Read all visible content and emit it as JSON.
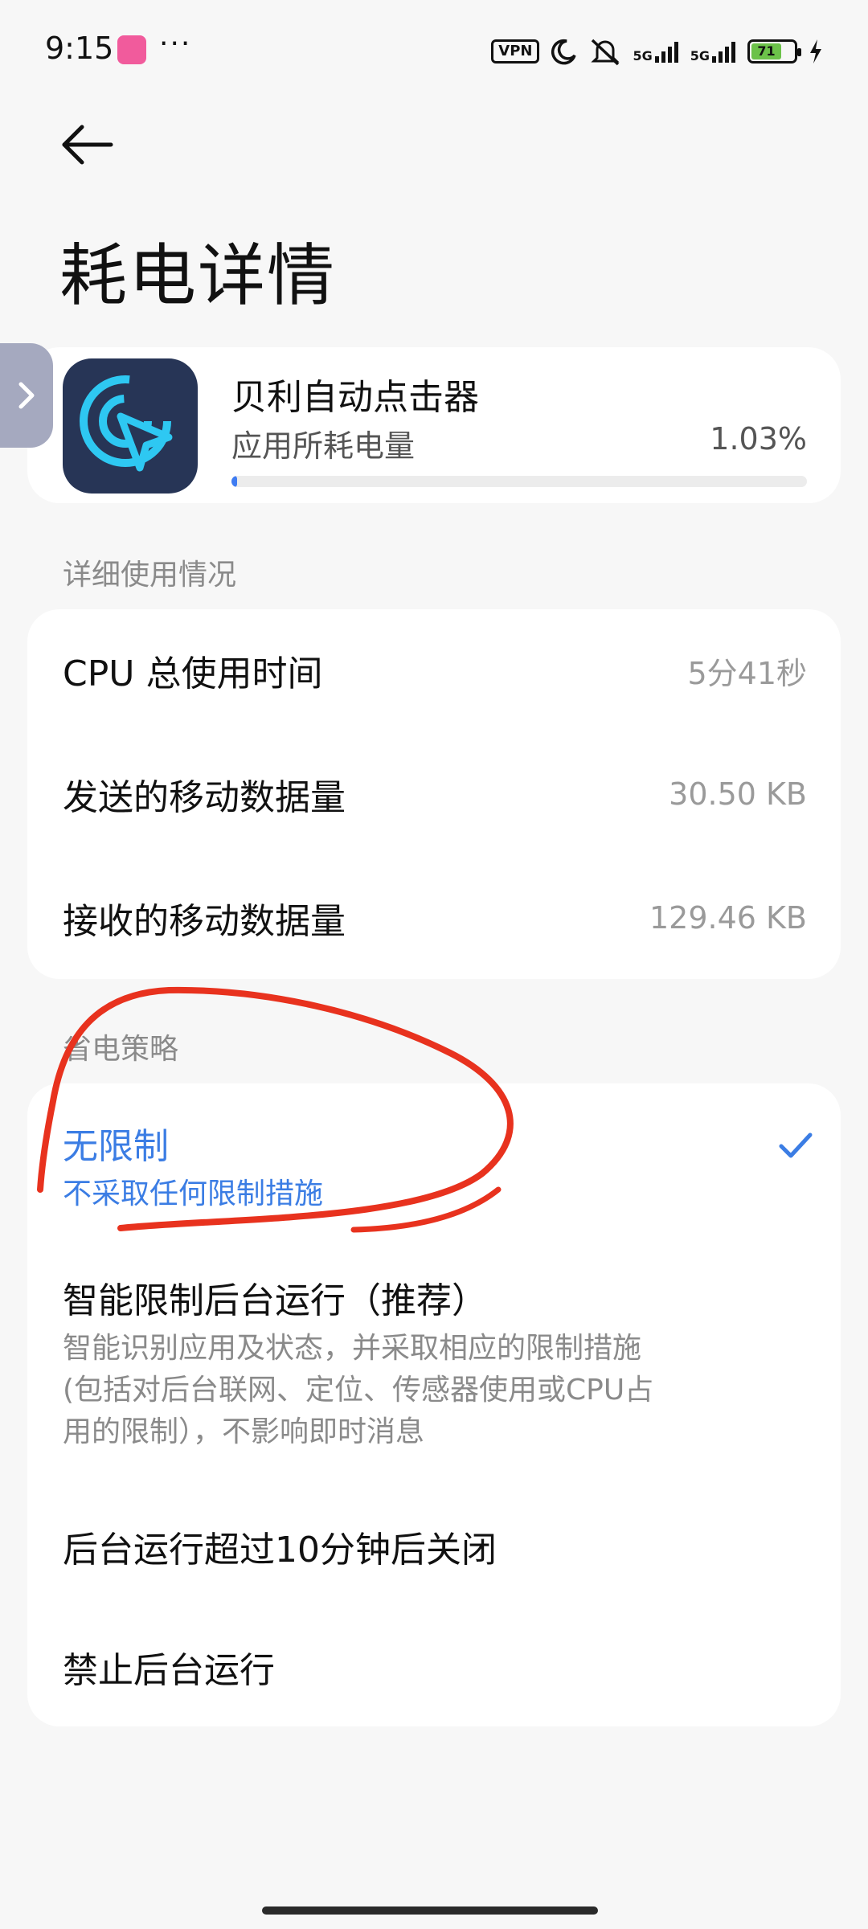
{
  "status_bar": {
    "time": "9:15",
    "dots": "···",
    "vpn": "VPN",
    "sig1": "5G",
    "sig2": "5G",
    "battery": "71"
  },
  "header": {
    "title": "耗电详情"
  },
  "app_card": {
    "name": "贝利自动点击器",
    "usage_label": "应用所耗电量",
    "usage_value": "1.03%",
    "usage_percent": 1.03
  },
  "detail_section": {
    "label": "详细使用情况",
    "rows": [
      {
        "label": "CPU 总使用时间",
        "value": "5分41秒"
      },
      {
        "label": "发送的移动数据量",
        "value": "30.50 KB"
      },
      {
        "label": "接收的移动数据量",
        "value": "129.46 KB"
      }
    ]
  },
  "policy_section": {
    "label": "省电策略",
    "options": [
      {
        "title": "无限制",
        "desc": "不采取任何限制措施",
        "selected": true
      },
      {
        "title": "智能限制后台运行（推荐）",
        "desc_lines": [
          "智能识别应用及状态，并采取相应的限制措施",
          "(包括对后台联网、定位、传感器使用或CPU占",
          "用的限制），不影响即时消息"
        ],
        "selected": false
      },
      {
        "title": "后台运行超过10分钟后关闭",
        "selected": false
      },
      {
        "title": "禁止后台运行",
        "selected": false
      }
    ]
  },
  "colors": {
    "accent": "#3b7de4",
    "annotation": "#e8321e",
    "app_icon_bg": "#273556"
  }
}
